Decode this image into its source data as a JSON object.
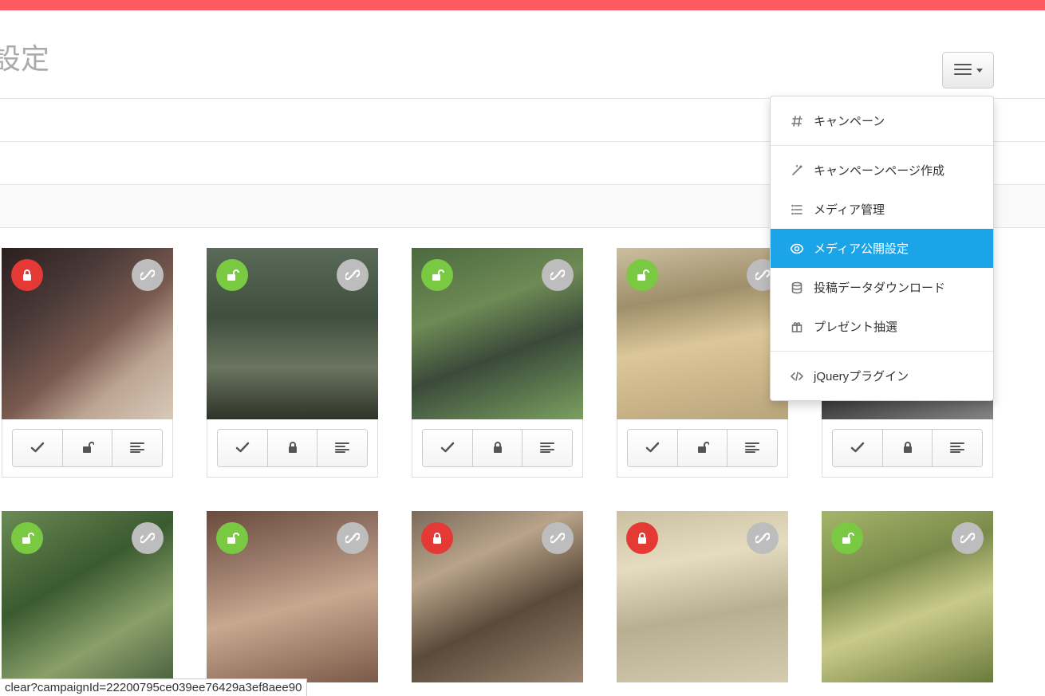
{
  "page": {
    "title_fragment": "設定"
  },
  "menu": {
    "items": [
      {
        "icon": "hash",
        "label": "キャンペーン",
        "active": false
      },
      {
        "sep": true
      },
      {
        "icon": "wand",
        "label": "キャンペーンページ作成",
        "active": false
      },
      {
        "icon": "list",
        "label": "メディア管理",
        "active": false
      },
      {
        "icon": "eye",
        "label": "メディア公開設定",
        "active": true
      },
      {
        "icon": "db",
        "label": "投稿データダウンロード",
        "active": false
      },
      {
        "icon": "gift",
        "label": "プレゼント抽選",
        "active": false
      },
      {
        "sep": true
      },
      {
        "icon": "code",
        "label": "jQueryプラグイン",
        "active": false
      }
    ]
  },
  "media": {
    "items": [
      {
        "lock": "locked",
        "bg": "ph1",
        "footer_lock": "unlock"
      },
      {
        "lock": "unlocked",
        "bg": "ph2",
        "footer_lock": "lock"
      },
      {
        "lock": "unlocked",
        "bg": "ph3",
        "footer_lock": "lock"
      },
      {
        "lock": "unlocked",
        "bg": "ph4",
        "footer_lock": "unlock"
      },
      {
        "lock": "unlocked",
        "bg": "ph5",
        "footer_lock": "lock"
      },
      {
        "lock": "unlocked",
        "bg": "ph6",
        "footer_lock": null
      },
      {
        "lock": "unlocked",
        "bg": "ph7",
        "footer_lock": null
      },
      {
        "lock": "locked",
        "bg": "ph8",
        "footer_lock": null
      },
      {
        "lock": "locked",
        "bg": "ph9",
        "footer_lock": null
      },
      {
        "lock": "unlocked",
        "bg": "ph10",
        "footer_lock": null
      }
    ]
  },
  "status_url": "clear?campaignId=22200795ce039ee76429a3ef8aee90"
}
